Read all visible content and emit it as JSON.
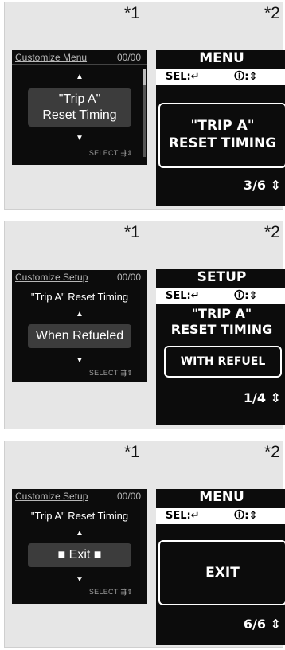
{
  "markers": {
    "left": "*1",
    "right": "*2"
  },
  "panels": [
    {
      "screen1": {
        "header_title": "Customize Menu",
        "header_count": "00/00",
        "subtitle": "",
        "option": "\"Trip A\"\nReset Timing",
        "select_label": "SELECT"
      },
      "screen2": {
        "title": "MENU",
        "sel_label": "SEL:↵",
        "info_label": "🛈:⇕",
        "box_text": "\"TRIP A\"\nRESET TIMING",
        "page": "3/6 ⇕"
      }
    },
    {
      "screen1": {
        "header_title": "Customize Setup",
        "header_count": "00/00",
        "subtitle": "\"Trip A\" Reset Timing",
        "option": "When Refueled",
        "select_label": "SELECT"
      },
      "screen2": {
        "title": "SETUP",
        "sel_label": "SEL:↵",
        "info_label": "🛈:⇕",
        "heading": "\"TRIP A\"\nRESET TIMING",
        "box_text": "WITH REFUEL",
        "page": "1/4 ⇕"
      }
    },
    {
      "screen1": {
        "header_title": "Customize Setup",
        "header_count": "00/00",
        "subtitle": "\"Trip A\" Reset Timing",
        "option": "■ Exit ■",
        "select_label": "SELECT"
      },
      "screen2": {
        "title": "MENU",
        "sel_label": "SEL:↵",
        "info_label": "🛈:⇕",
        "box_text": "EXIT",
        "page": "6/6 ⇕"
      }
    }
  ]
}
